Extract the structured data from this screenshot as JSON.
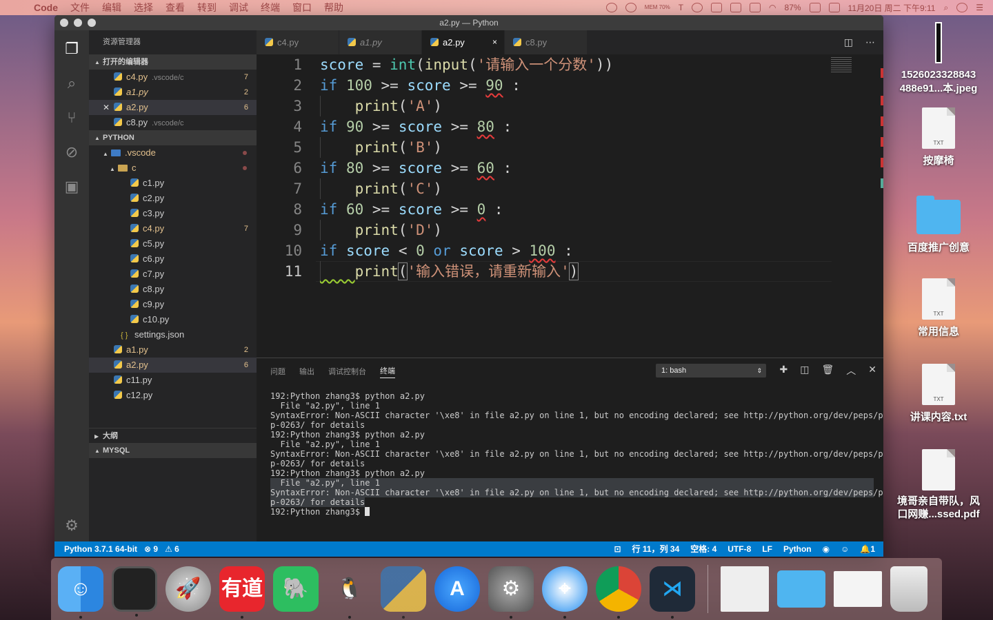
{
  "menubar": {
    "apple": "",
    "items": [
      "Code",
      "文件",
      "编辑",
      "选择",
      "查看",
      "转到",
      "调试",
      "终端",
      "窗口",
      "帮助"
    ],
    "mem": "MEM 70%",
    "battery": "87%",
    "datetime": "11月20日 周二 下午9:11"
  },
  "window": {
    "title": "a2.py — Python"
  },
  "sidebar": {
    "title": "资源管理器",
    "open_editors_label": "打开的编辑器",
    "open_editors": [
      {
        "name": "c4.py",
        "path": ".vscode/c",
        "badge": "7"
      },
      {
        "name": "a1.py",
        "path": "",
        "badge": "2"
      },
      {
        "name": "a2.py",
        "path": "",
        "badge": "6"
      },
      {
        "name": "c8.py",
        "path": ".vscode/c",
        "badge": ""
      }
    ],
    "python_label": "PYTHON",
    "vscode_folder": ".vscode",
    "c_folder": "c",
    "c_files": [
      {
        "name": "c1.py",
        "badge": ""
      },
      {
        "name": "c2.py",
        "badge": ""
      },
      {
        "name": "c3.py",
        "badge": ""
      },
      {
        "name": "c4.py",
        "badge": "7"
      },
      {
        "name": "c5.py",
        "badge": ""
      },
      {
        "name": "c6.py",
        "badge": ""
      },
      {
        "name": "c7.py",
        "badge": ""
      },
      {
        "name": "c8.py",
        "badge": ""
      },
      {
        "name": "c9.py",
        "badge": ""
      },
      {
        "name": "c10.py",
        "badge": ""
      }
    ],
    "settings": "settings.json",
    "root_files": [
      {
        "name": "a1.py",
        "badge": "2"
      },
      {
        "name": "a2.py",
        "badge": "6"
      },
      {
        "name": "c11.py",
        "badge": ""
      },
      {
        "name": "c12.py",
        "badge": ""
      }
    ],
    "outline_label": "大纲",
    "mysql_label": "MYSQL"
  },
  "tabs": [
    {
      "label": "c4.py"
    },
    {
      "label": "a1.py"
    },
    {
      "label": "a2.py",
      "close": "×"
    },
    {
      "label": "c8.py"
    }
  ],
  "editor": {
    "line_numbers": [
      "1",
      "2",
      "3",
      "4",
      "5",
      "6",
      "7",
      "8",
      "9",
      "10",
      "11"
    ],
    "lines": [
      "score = int(input('请输入一个分数'))",
      "if 100 >= score >= 90 :",
      "    print('A')",
      "if 90 >= score >= 80 :",
      "    print('B')",
      "if 80 >= score >= 60 :",
      "    print('C')",
      "if 60 >= score >= 0 :",
      "    print('D')",
      "if score < 0 or score > 100 :",
      "    print('输入错误，请重新输入')"
    ]
  },
  "panel": {
    "tabs": [
      "问题",
      "输出",
      "调试控制台",
      "终端"
    ],
    "terminal_select": "1: bash",
    "terminal_lines": [
      "192:Python zhang3$ python a2.py",
      "  File \"a2.py\", line 1",
      "SyntaxError: Non-ASCII character '\\xe8' in file a2.py on line 1, but no encoding declared; see http://python.org/dev/peps/pe",
      "p-0263/ for details",
      "192:Python zhang3$ python a2.py",
      "  File \"a2.py\", line 1",
      "SyntaxError: Non-ASCII character '\\xe8' in file a2.py on line 1, but no encoding declared; see http://python.org/dev/peps/pe",
      "p-0263/ for details",
      "192:Python zhang3$ python a2.py",
      "  File \"a2.py\", line 1",
      "SyntaxError: Non-ASCII character '\\xe8' in file a2.py on line 1, but no encoding declared; see http://python.org/dev/peps/pe",
      "p-0263/ for details",
      "192:Python zhang3$ "
    ]
  },
  "statusbar": {
    "interpreter": "Python 3.7.1 64-bit",
    "errors": "⊗ 9",
    "warnings": "⚠ 6",
    "position": "行 11，列 34",
    "spaces": "空格: 4",
    "encoding": "UTF-8",
    "eol": "LF",
    "language": "Python",
    "notifications": "1"
  },
  "desktop": [
    {
      "label": "1526023328843\n488e91...本.jpeg",
      "kind": "jpeg"
    },
    {
      "label": "按摩椅",
      "kind": "txt"
    },
    {
      "label": "百度推广创意",
      "kind": "folder"
    },
    {
      "label": "常用信息",
      "kind": "txt"
    },
    {
      "label": "讲课内容.txt",
      "kind": "txt"
    },
    {
      "label": "境哥亲自带队，风\n口网赚...ssed.pdf",
      "kind": "pdf"
    }
  ],
  "dock": {
    "youdao_label": "有道"
  },
  "colors": {
    "accent": "#007acc",
    "editor_bg": "#1e1e1e",
    "sidebar_bg": "#252526"
  }
}
